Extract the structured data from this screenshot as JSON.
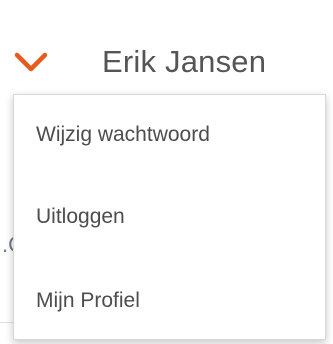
{
  "user_menu": {
    "name": "Erik Jansen",
    "toggle_icon": "chevron-down-icon",
    "accent_color": "#e85a1c",
    "items": [
      {
        "label": "Wijzig wachtwoord"
      },
      {
        "label": "Uitloggen"
      },
      {
        "label": "Mijn Profiel"
      }
    ]
  },
  "background": {
    "partial_glyph": ".C"
  }
}
